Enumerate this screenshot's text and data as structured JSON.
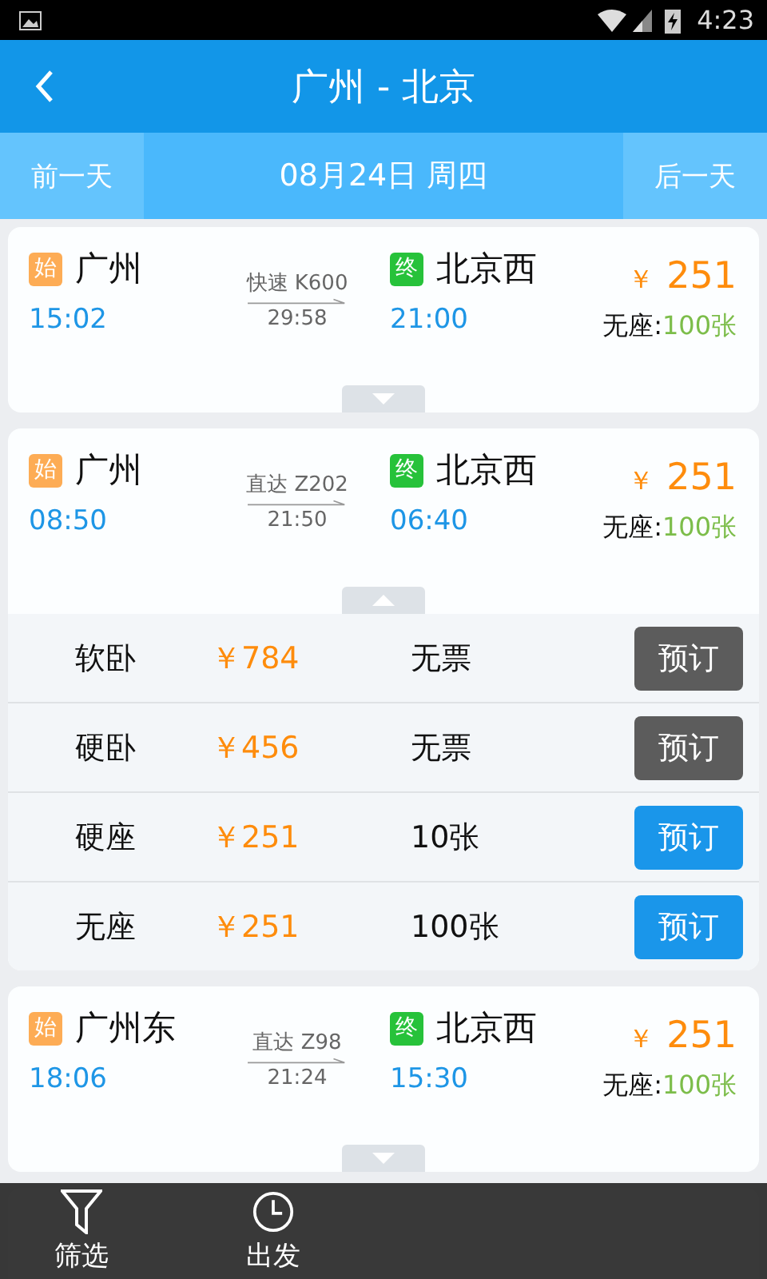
{
  "status_bar": {
    "time": "4:23"
  },
  "header": {
    "title": "广州 - 北京"
  },
  "date_bar": {
    "prev": "前一天",
    "date": "08月24日 周四",
    "next": "后一天"
  },
  "trains": [
    {
      "from_badge": "始",
      "from": "广州",
      "depart": "15:02",
      "train": "快速 K600",
      "duration": "29:58",
      "to_badge": "终",
      "to": "北京西",
      "arrive": "21:00",
      "price": "251",
      "currency": "￥",
      "seat_label": "无座:",
      "seat_count": "100张",
      "expanded": false
    },
    {
      "from_badge": "始",
      "from": "广州",
      "depart": "08:50",
      "train": "直达 Z202",
      "duration": "21:50",
      "to_badge": "终",
      "to": "北京西",
      "arrive": "06:40",
      "price": "251",
      "currency": "￥",
      "seat_label": "无座:",
      "seat_count": "100张",
      "expanded": true,
      "seats": [
        {
          "name": "软卧",
          "price": "￥784",
          "remain": "无票",
          "button": "预订",
          "disabled": true
        },
        {
          "name": "硬卧",
          "price": "￥456",
          "remain": "无票",
          "button": "预订",
          "disabled": true
        },
        {
          "name": "硬座",
          "price": "￥251",
          "remain": "10张",
          "button": "预订",
          "disabled": false
        },
        {
          "name": "无座",
          "price": "￥251",
          "remain": "100张",
          "button": "预订",
          "disabled": false
        }
      ]
    },
    {
      "from_badge": "始",
      "from": "广州东",
      "depart": "18:06",
      "train": "直达 Z98",
      "duration": "21:24",
      "to_badge": "终",
      "to": "北京西",
      "arrive": "15:30",
      "price": "251",
      "currency": "￥",
      "seat_label": "无座:",
      "seat_count": "100张",
      "expanded": false
    }
  ],
  "bottom_bar": [
    {
      "label": "筛选",
      "kind": "filter"
    },
    {
      "label": "出发",
      "kind": "clock"
    }
  ]
}
